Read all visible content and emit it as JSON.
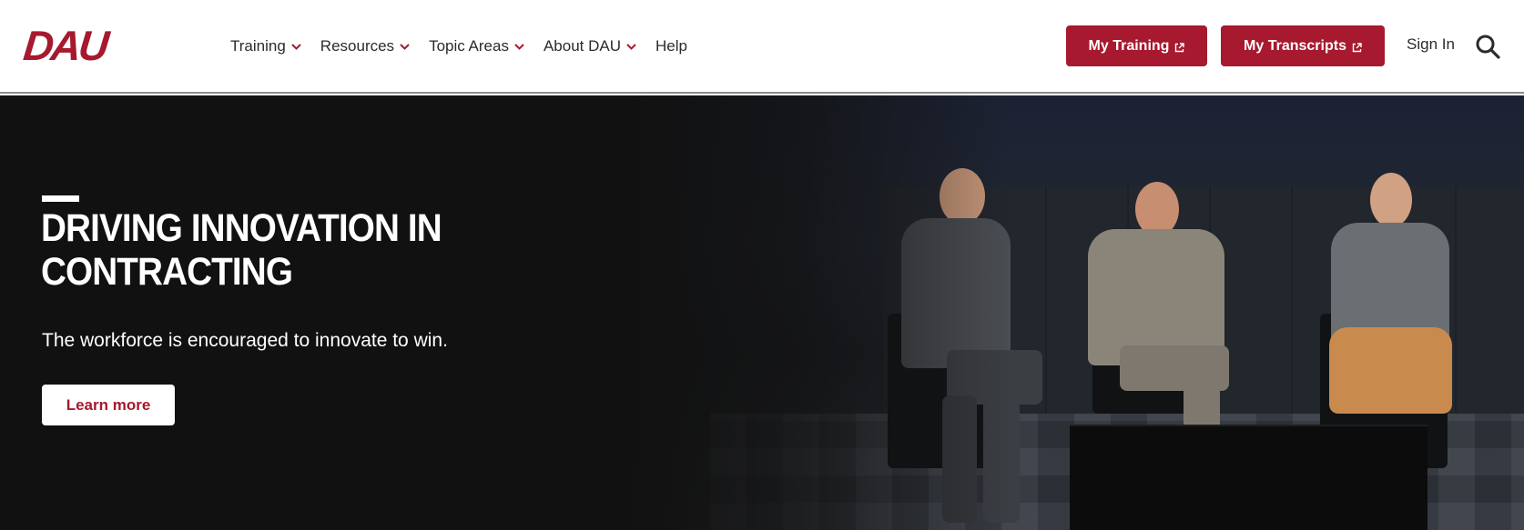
{
  "brand": {
    "logo_text": "DAU",
    "accent_color": "#a6192e"
  },
  "nav": {
    "items": [
      {
        "label": "Training",
        "has_dropdown": true
      },
      {
        "label": "Resources",
        "has_dropdown": true
      },
      {
        "label": "Topic Areas",
        "has_dropdown": true
      },
      {
        "label": "About DAU",
        "has_dropdown": true
      },
      {
        "label": "Help",
        "has_dropdown": false
      }
    ]
  },
  "actions": {
    "my_training": "My Training",
    "my_transcripts": "My Transcripts",
    "sign_in": "Sign In",
    "search_icon": "search-icon",
    "external_icon": "external-link-icon"
  },
  "hero": {
    "title": "DRIVING INNOVATION IN CONTRACTING",
    "subtitle": "The workforce is encouraged to innovate to win.",
    "cta": "Learn more"
  }
}
